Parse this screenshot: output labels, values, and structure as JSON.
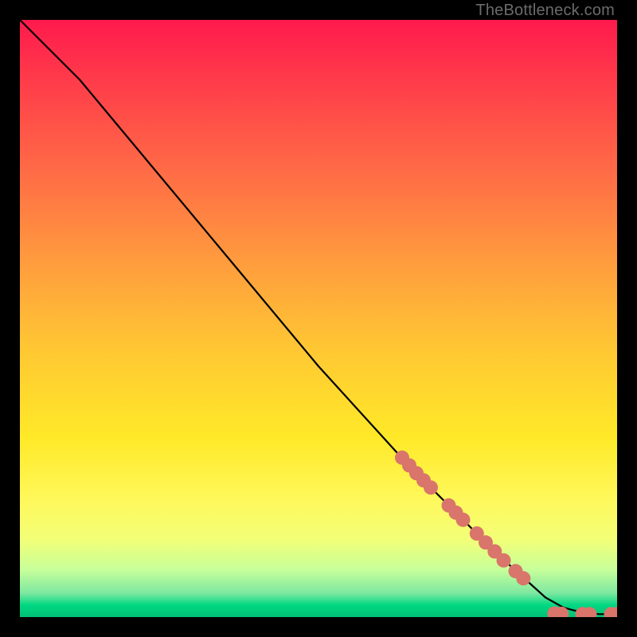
{
  "watermark": "TheBottleneck.com",
  "chart_data": {
    "type": "line",
    "title": "",
    "xlabel": "",
    "ylabel": "",
    "xlim": [
      0,
      100
    ],
    "ylim": [
      0,
      100
    ],
    "grid": false,
    "curve": {
      "name": "main-curve",
      "color": "#000000",
      "x": [
        0,
        3,
        6,
        10,
        15,
        20,
        25,
        30,
        35,
        40,
        45,
        50,
        55,
        60,
        65,
        70,
        75,
        80,
        85,
        88,
        91,
        94,
        97,
        100
      ],
      "y": [
        100,
        97,
        94,
        90,
        84,
        78,
        72,
        66,
        60,
        54,
        48,
        42,
        36.5,
        31,
        25.5,
        20.5,
        15.5,
        10.5,
        6,
        3.3,
        1.6,
        0.8,
        0.5,
        0.5
      ]
    },
    "markers": {
      "name": "highlight-points",
      "color": "#d9756b",
      "radius": 9,
      "points": [
        {
          "x": 64.0,
          "y": 26.7
        },
        {
          "x": 65.2,
          "y": 25.4
        },
        {
          "x": 66.4,
          "y": 24.1
        },
        {
          "x": 67.6,
          "y": 22.9
        },
        {
          "x": 68.8,
          "y": 21.7
        },
        {
          "x": 71.8,
          "y": 18.7
        },
        {
          "x": 73.0,
          "y": 17.5
        },
        {
          "x": 74.2,
          "y": 16.3
        },
        {
          "x": 76.5,
          "y": 14.0
        },
        {
          "x": 78.0,
          "y": 12.5
        },
        {
          "x": 79.5,
          "y": 11.0
        },
        {
          "x": 81.0,
          "y": 9.5
        },
        {
          "x": 83.0,
          "y": 7.7
        },
        {
          "x": 84.3,
          "y": 6.5
        },
        {
          "x": 89.5,
          "y": 0.6
        },
        {
          "x": 90.7,
          "y": 0.55
        },
        {
          "x": 94.2,
          "y": 0.5
        },
        {
          "x": 95.4,
          "y": 0.5
        },
        {
          "x": 99.0,
          "y": 0.5
        },
        {
          "x": 100.0,
          "y": 0.5
        }
      ]
    }
  }
}
